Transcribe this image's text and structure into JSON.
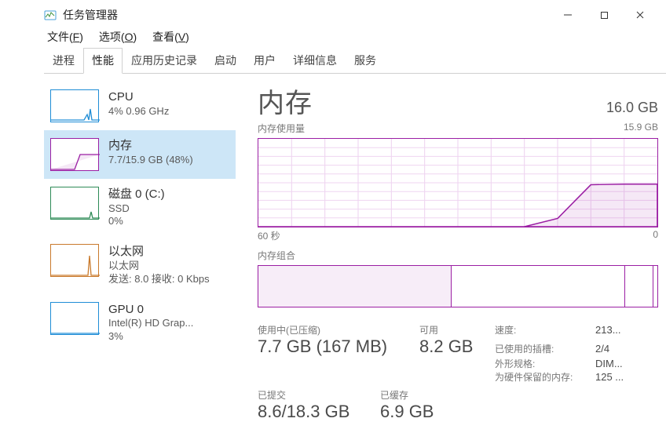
{
  "window": {
    "title": "任务管理器"
  },
  "menu": {
    "file": {
      "pre": "文件(",
      "u": "F",
      "post": ")"
    },
    "options": {
      "pre": "选项(",
      "u": "O",
      "post": ")"
    },
    "view": {
      "pre": "查看(",
      "u": "V",
      "post": ")"
    }
  },
  "tabs": {
    "processes": "进程",
    "performance": "性能",
    "apphistory": "应用历史记录",
    "startup": "启动",
    "users": "用户",
    "details": "详细信息",
    "services": "服务"
  },
  "sidebar": {
    "cpu": {
      "title": "CPU",
      "sub": "4%  0.96 GHz"
    },
    "mem": {
      "title": "内存",
      "sub": "7.7/15.9 GB (48%)"
    },
    "disk": {
      "title": "磁盘 0 (C:)",
      "sub1": "SSD",
      "sub2": "0%"
    },
    "eth": {
      "title": "以太网",
      "sub1": "以太网",
      "sub2": "发送: 8.0  接收: 0 Kbps"
    },
    "gpu": {
      "title": "GPU 0",
      "sub1": "Intel(R) HD Grap...",
      "sub2": "3%"
    }
  },
  "main": {
    "heading": "内存",
    "total": "16.0 GB",
    "usage_label": "内存使用量",
    "usage_max": "15.9 GB",
    "axis_left": "60 秒",
    "axis_right": "0",
    "composition_label": "内存组合",
    "stats": {
      "inuse_label": "使用中(已压缩)",
      "inuse_value": "7.7 GB (167 MB)",
      "avail_label": "可用",
      "avail_value": "8.2 GB",
      "committed_label": "已提交",
      "committed_value": "8.6/18.3 GB",
      "cached_label": "已缓存",
      "cached_value": "6.9 GB",
      "speed_label": "速度:",
      "speed_value": "213...",
      "slots_label": "已使用的插槽:",
      "slots_value": "2/4",
      "form_label": "外形规格:",
      "form_value": "DIM...",
      "reserved_label": "为硬件保留的内存:",
      "reserved_value": "125 ..."
    }
  },
  "chart_data": {
    "type": "area",
    "title": "内存使用量",
    "xlabel": "60 秒 → 0",
    "ylabel": "GB",
    "ylim": [
      0,
      15.9
    ],
    "x": [
      60,
      55,
      50,
      45,
      40,
      35,
      30,
      25,
      20,
      15,
      10,
      5,
      0
    ],
    "series": [
      {
        "name": "内存使用率",
        "values": [
          0,
          0,
          0,
          0,
          0,
          0,
          0,
          0,
          0,
          1.5,
          7.6,
          7.7,
          7.7
        ]
      }
    ],
    "composition": {
      "type": "stacked-bar",
      "total_gb": 15.9,
      "segments": [
        {
          "name": "使用中",
          "gb": 7.7,
          "fill": true
        },
        {
          "name": "已缓存",
          "gb": 6.9,
          "fill": false
        },
        {
          "name": "可用",
          "gb": 1.1,
          "fill": false
        },
        {
          "name": "保留",
          "gb": 0.2,
          "fill": false
        }
      ]
    }
  }
}
